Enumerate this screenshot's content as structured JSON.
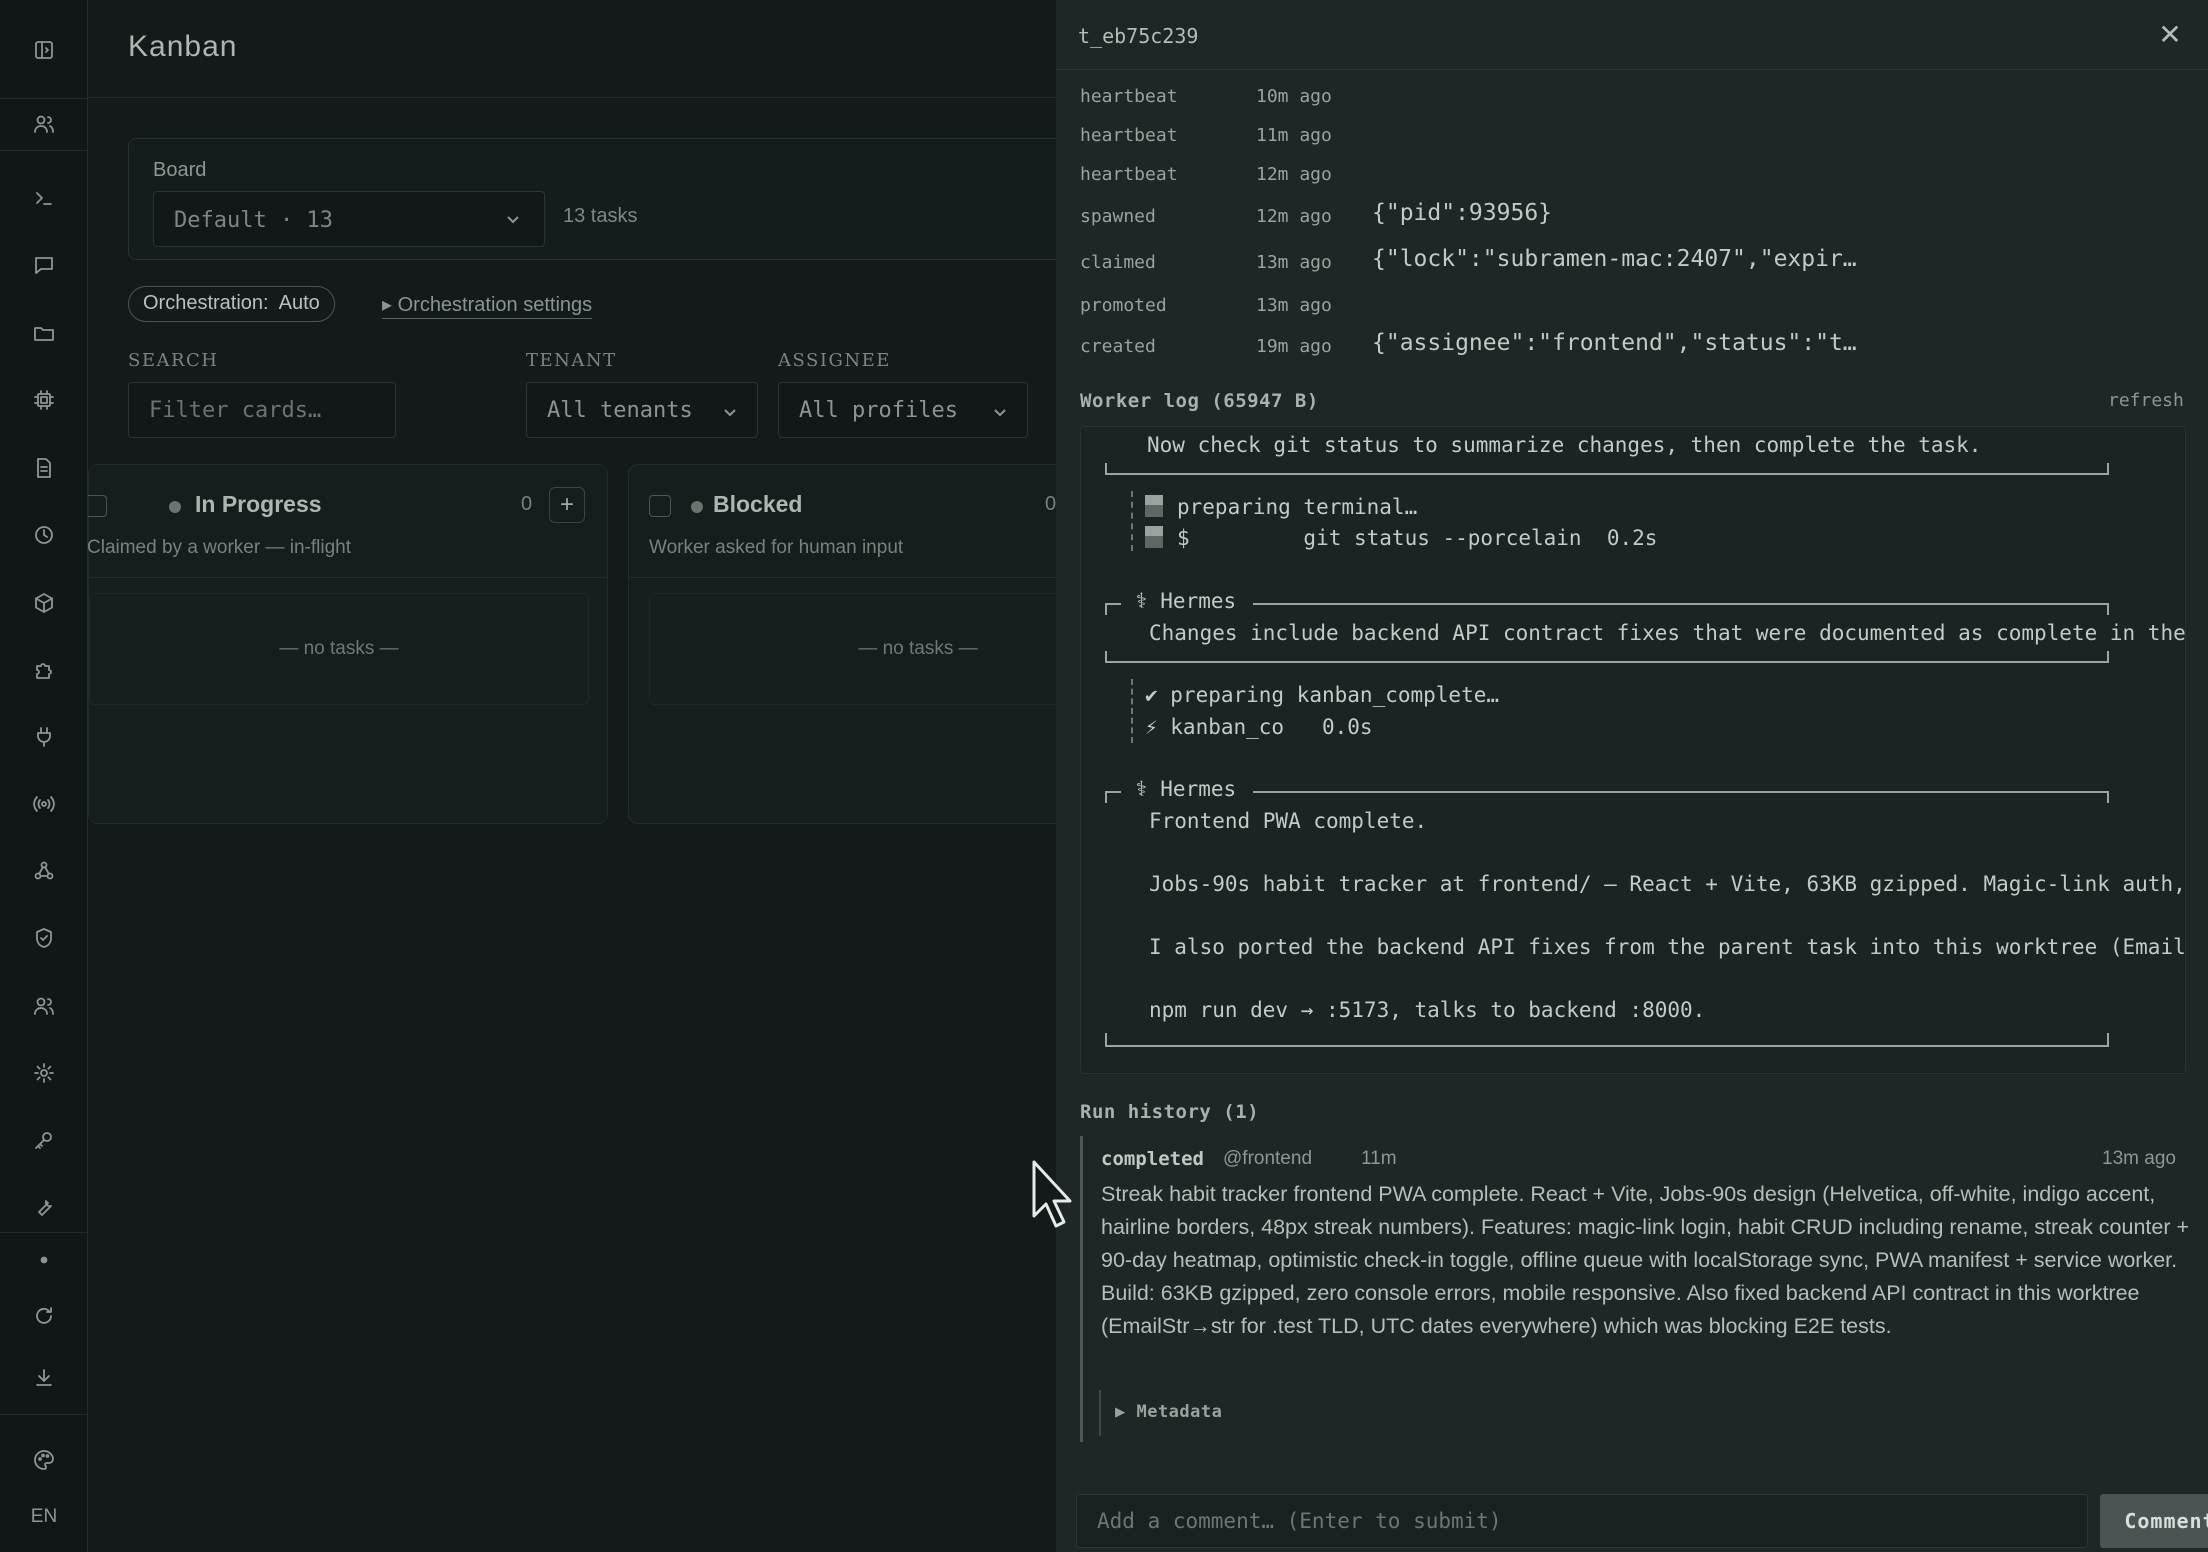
{
  "sidebar": {
    "icons": [
      "panel-toggle-icon",
      "users-icon",
      "terminal-icon",
      "chat-icon",
      "folder-icon",
      "cpu-icon",
      "document-icon",
      "clock-icon",
      "cube-icon",
      "puzzle-icon",
      "plug-icon",
      "broadcast-icon",
      "webhook-icon",
      "shield-icon",
      "people-icon",
      "gear-icon",
      "key-icon",
      "wrench-icon",
      "dot-icon",
      "refresh-icon",
      "download-icon",
      "palette-icon"
    ],
    "language": "EN"
  },
  "main": {
    "title": "Kanban",
    "board_label": "Board",
    "board_value": "Default · 13",
    "task_count": "13 tasks",
    "orchestration_label": "Orchestration:",
    "orchestration_value": "Auto",
    "orchestration_settings": "▸ Orchestration settings",
    "filters": {
      "search_label": "SEARCH",
      "search_placeholder": "Filter cards…",
      "tenant_label": "TENANT",
      "tenant_value": "All tenants",
      "assignee_label": "ASSIGNEE",
      "assignee_value": "All profiles"
    },
    "columns": [
      {
        "title": "In Progress",
        "subtitle": "Claimed by a worker — in-flight",
        "count": "0",
        "empty": "— no tasks —"
      },
      {
        "title": "Blocked",
        "subtitle": "Worker asked for human input",
        "count": "0",
        "empty": "— no tasks —"
      }
    ]
  },
  "panel": {
    "task_id": "t_eb75c239",
    "close": "✕",
    "events": [
      {
        "name": "heartbeat",
        "time": "10m ago",
        "payload": ""
      },
      {
        "name": "heartbeat",
        "time": "11m ago",
        "payload": ""
      },
      {
        "name": "heartbeat",
        "time": "12m ago",
        "payload": ""
      },
      {
        "name": "spawned",
        "time": "12m ago",
        "payload": "{\"pid\":93956}"
      },
      {
        "name": "claimed",
        "time": "13m ago",
        "payload": "{\"lock\":\"subramen-mac:2407\",\"expir…"
      },
      {
        "name": "promoted",
        "time": "13m ago",
        "payload": ""
      },
      {
        "name": "created",
        "time": "19m ago",
        "payload": "{\"assignee\":\"frontend\",\"status\":\"t…"
      }
    ],
    "worker_log_title": "Worker log (65947 B)",
    "refresh": "refresh",
    "log": {
      "l1": "Now check git status to summarize changes, then complete the task.",
      "l2": "preparing terminal…",
      "l3": "$         git status --porcelain  0.2s",
      "l4": "⚕ Hermes",
      "l5": "Changes include backend API contract fixes that were documented as complete in the",
      "l6": "✔ preparing kanban_complete…",
      "l7": "⚡ kanban_co   0.0s",
      "l8": "⚕ Hermes",
      "l9": "Frontend PWA complete.",
      "l10": "Jobs-90s habit tracker at frontend/ — React + Vite, 63KB gzipped. Magic-link auth,",
      "l11": "I also ported the backend API fixes from the parent task into this worktree (Email",
      "l12": "npm run dev → :5173, talks to backend :8000."
    },
    "run_history_title": "Run history (1)",
    "run": {
      "status": "completed",
      "worker": "@frontend",
      "duration": "11m",
      "ago": "13m ago",
      "summary": "Streak habit tracker frontend PWA complete. React + Vite, Jobs-90s design (Helvetica, off-white, indigo accent, hairline borders, 48px streak numbers). Features: magic-link login, habit CRUD including rename, streak counter + 90-day heatmap, optimistic check-in toggle, offline queue with localStorage sync, PWA manifest + service worker. Build: 63KB gzipped, zero console errors, mobile responsive. Also fixed backend API contract in this worktree (EmailStr→str for .test TLD, UTC dates everywhere) which was blocking E2E tests.",
      "metadata": "▶ Metadata"
    },
    "comment_placeholder": "Add a comment… (Enter to submit)",
    "comment_button": "Comment"
  }
}
